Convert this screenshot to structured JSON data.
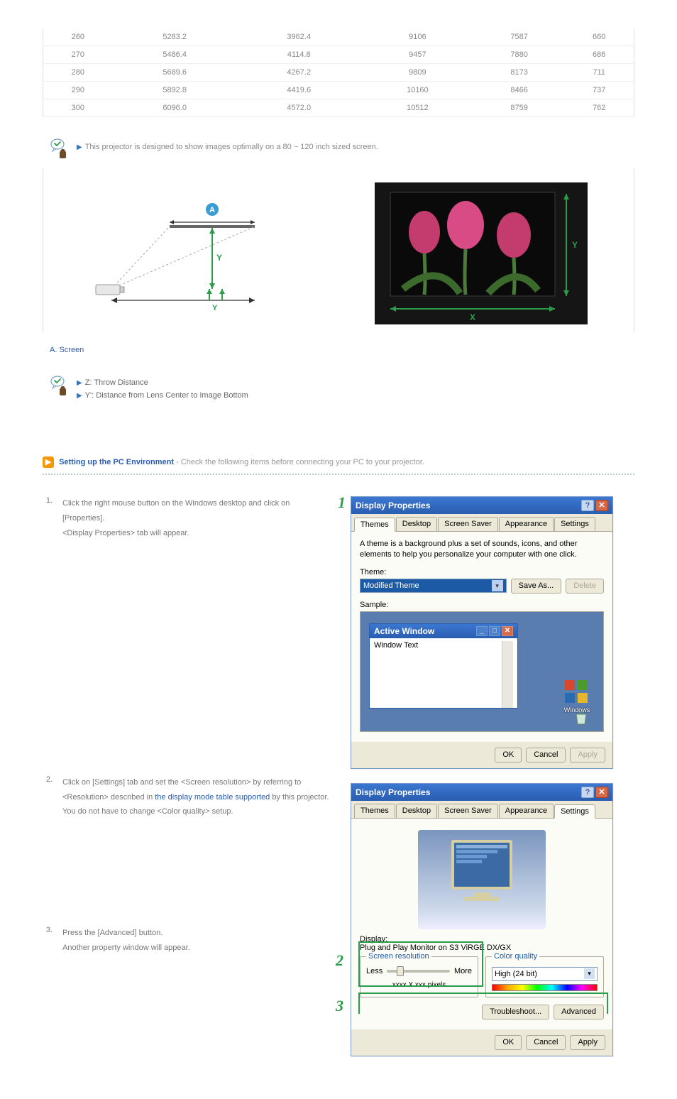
{
  "chart_data": {
    "type": "table",
    "rows": [
      {
        "c0": "260",
        "c1": "5283.2",
        "c2": "3962.4",
        "c3": "9106",
        "c4": "7587",
        "c5": "660"
      },
      {
        "c0": "270",
        "c1": "5486.4",
        "c2": "4114.8",
        "c3": "9457",
        "c4": "7880",
        "c5": "686"
      },
      {
        "c0": "280",
        "c1": "5689.6",
        "c2": "4267.2",
        "c3": "9809",
        "c4": "8173",
        "c5": "711"
      },
      {
        "c0": "290",
        "c1": "5892.8",
        "c2": "4419.6",
        "c3": "10160",
        "c4": "8466",
        "c5": "737"
      },
      {
        "c0": "300",
        "c1": "6096.0",
        "c2": "4572.0",
        "c3": "10512",
        "c4": "8759",
        "c5": "762"
      }
    ]
  },
  "note_projector": "This projector is designed to show images optimally on a 80 ~ 120 inch sized screen.",
  "diagram": {
    "axis_x": "X",
    "axis_y": "Y",
    "axis_z_arrow": "▲"
  },
  "caption_screen": "A. Screen",
  "legend_z": "Z: Throw Distance",
  "legend_y": "Y': Distance from Lens Center to Image Bottom",
  "heading": {
    "badge": "▶",
    "title": "Setting up the PC Environment",
    "sub": " - Check the following items before connecting your PC to your projector."
  },
  "steps": {
    "n1": "1.",
    "s1a": "Click the right mouse button on the Windows desktop and click on [Properties].",
    "s1b": "<Display Properties> tab will appear.",
    "n2": "2.",
    "s2a": "Click on [Settings] tab and set the <Screen resolution> by referring to <Resolution> described in ",
    "s2link": "the display mode table supported",
    "s2a_tail": " by this projector.",
    "s2b": "You do not have to change <Color quality> setup.",
    "n3": "3.",
    "s3a": "Press the [Advanced] button.",
    "s3b": "Another property window will appear."
  },
  "markers": {
    "m1": "1",
    "m2": "2",
    "m3": "3"
  },
  "dlg1": {
    "title": "Display Properties",
    "help_btn": "?",
    "close_btn": "✕",
    "tabs": {
      "themes": "Themes",
      "desktop": "Desktop",
      "saver": "Screen Saver",
      "appearance": "Appearance",
      "settings": "Settings"
    },
    "desc": "A theme is a background plus a set of sounds, icons, and other elements to help you personalize your computer with one click.",
    "theme_lbl": "Theme:",
    "theme_value": "Modified Theme",
    "save_as": "Save As...",
    "delete": "Delete",
    "sample_lbl": "Sample:",
    "aw_title": "Active Window",
    "aw_text": "Window Text",
    "windows_lbl": "Windows",
    "ok": "OK",
    "cancel": "Cancel",
    "apply": "Apply"
  },
  "dlg2": {
    "title": "Display Properties",
    "display_lbl": "Display:",
    "display_value": "Plug and Play Monitor on S3 ViRGE DX/GX",
    "sr_legend": "Screen resolution",
    "less": "Less",
    "more": "More",
    "pixels": "xxxx X xxx pixels",
    "cq_legend": "Color quality",
    "cq_value": "High (24 bit)",
    "troubleshoot": "Troubleshoot...",
    "advanced": "Advanced",
    "ok": "OK",
    "cancel": "Cancel",
    "apply": "Apply"
  }
}
